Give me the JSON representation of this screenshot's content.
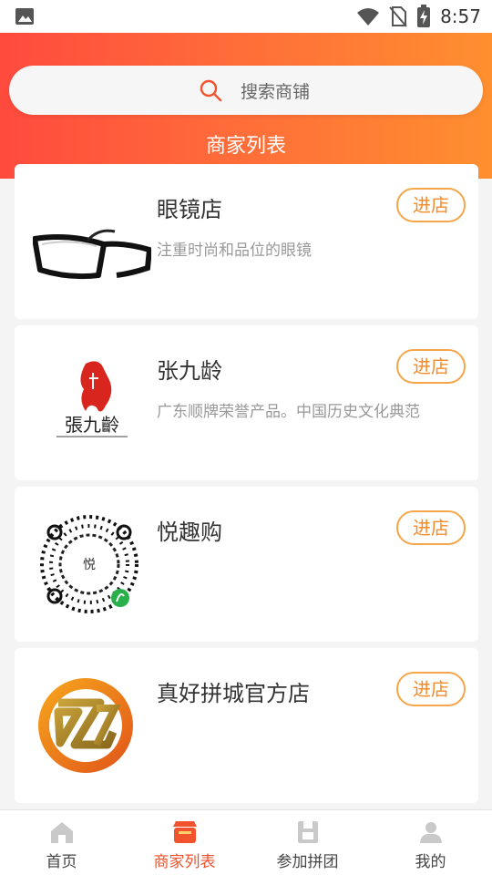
{
  "status_bar": {
    "time": "8:57"
  },
  "search": {
    "placeholder": "搜索商铺"
  },
  "header": {
    "title": "商家列表"
  },
  "shops": [
    {
      "name": "眼镜店",
      "desc": "注重时尚和品位的眼镜",
      "enter_label": "进店",
      "icon": "glasses-image"
    },
    {
      "name": "张九龄",
      "desc": "广东顺牌荣誉产品。中国历史文化典范",
      "enter_label": "进店",
      "icon": "zhangjiuling-logo",
      "logo_text": "張九齡"
    },
    {
      "name": "悦趣购",
      "desc": "",
      "enter_label": "进店",
      "icon": "mini-program-qr"
    },
    {
      "name": "真好拼城官方店",
      "desc": "",
      "enter_label": "进店",
      "icon": "zh-logo"
    }
  ],
  "tabbar": {
    "items": [
      {
        "label": "首页",
        "icon": "home-icon",
        "active": false
      },
      {
        "label": "商家列表",
        "icon": "store-icon",
        "active": true
      },
      {
        "label": "参加拼团",
        "icon": "group-icon",
        "active": false
      },
      {
        "label": "我的",
        "icon": "user-icon",
        "active": false
      }
    ]
  },
  "colors": {
    "accent": "#f0532e",
    "enter_border": "#f5a54a",
    "gradient_start": "#ff4a3e",
    "gradient_end": "#ff8f2f"
  }
}
